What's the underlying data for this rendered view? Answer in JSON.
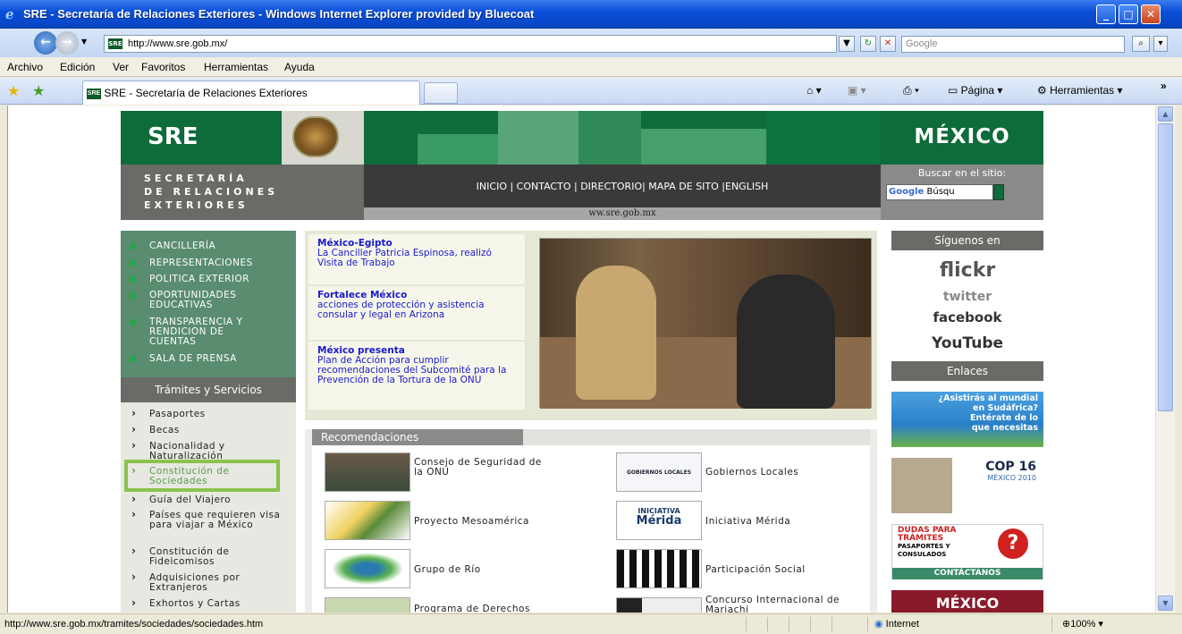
{
  "window": {
    "title": "SRE - Secretaría de Relaciones Exteriores - Windows Internet Explorer provided by Bluecoat"
  },
  "address": {
    "url": "http://www.sre.gob.mx/",
    "search_placeholder": "Google"
  },
  "menu": [
    "Archivo",
    "Edición",
    "Ver",
    "Favoritos",
    "Herramientas",
    "Ayuda"
  ],
  "tab": {
    "label": "SRE - Secretaría de Relaciones Exteriores"
  },
  "toolbar": {
    "page": "Página",
    "tools": "Herramientas"
  },
  "site": {
    "logo": "SRE",
    "country": "MÉXICO",
    "secretaria": [
      "SECRETARÍA",
      "DE RELACIONES",
      "EXTERIORES"
    ],
    "nav": "INICIO | CONTACTO | DIRECTORIO| MAPA DE SITO |ENGLISH",
    "www": "ww.sre.gob.mx",
    "search_label": "Buscar en el sitio:",
    "search_box": "Búsqu",
    "left_nav": [
      "CANCILLERÍA",
      "REPRESENTACIONES",
      "POLITICA EXTERIOR",
      "OPORTUNIDADES EDUCATIVAS",
      "TRANSPARENCIA Y RENDICION DE CUENTAS",
      "SALA DE PRENSA"
    ],
    "tramites_header": "Trámites y Servicios",
    "tramites": [
      "Pasaportes",
      "Becas",
      "Nacionalidad y Naturalización",
      "Constitución de Sociedades",
      "Guía del Viajero",
      "Países que requieren visa para viajar a México",
      "Constitución de Fideicomisos",
      "Adquisiciones por Extranjeros",
      "Exhortos y Cartas"
    ],
    "news": [
      {
        "title": "México-Egipto",
        "text": "La Canciller Patricia Espinosa, realizó Visita de Trabajo"
      },
      {
        "title": "Fortalece México",
        "text": "acciones de protección y asistencia consular y legal en Arizona"
      },
      {
        "title": "México presenta",
        "text": "Plan de Acción para cumplir recomendaciones del Subcomité para la Prevención de la Tortura de la ONU"
      }
    ],
    "reco_header": "Recomendaciones",
    "reco": [
      "Consejo de Seguridad de la ONU",
      "Gobiernos Locales",
      "Proyecto Mesoamérica",
      "Iniciativa Mérida",
      "Grupo de Río",
      "Participación Social",
      "Programa de Derechos",
      "Concurso Internacional de Mariachi"
    ],
    "reco_img_text": {
      "merida_1": "INICIATIVA",
      "merida_2": "Mérida",
      "gob": "GOBIERNOS LOCALES"
    },
    "siguenos": "Síguenos en",
    "social": [
      "flickr",
      "twitter",
      "facebook",
      "YouTube"
    ],
    "enlaces": "Enlaces",
    "banners": {
      "mundial": [
        "¿Asistirás al mundial",
        "en Sudáfrica?",
        "Entérate de lo",
        "que necesitas"
      ],
      "cop": [
        "COP 16",
        "MÉXICO 2010"
      ],
      "dudas": [
        "DUDAS PARA",
        "TRÁMITES",
        "PASAPORTES Y",
        "CONSULADOS",
        "CONTÁCTANOS"
      ],
      "mexico": "MÉXICO"
    }
  },
  "status": {
    "text": "http://www.sre.gob.mx/tramites/sociedades/sociedades.htm",
    "zone": "Internet",
    "zoom": "100%"
  }
}
